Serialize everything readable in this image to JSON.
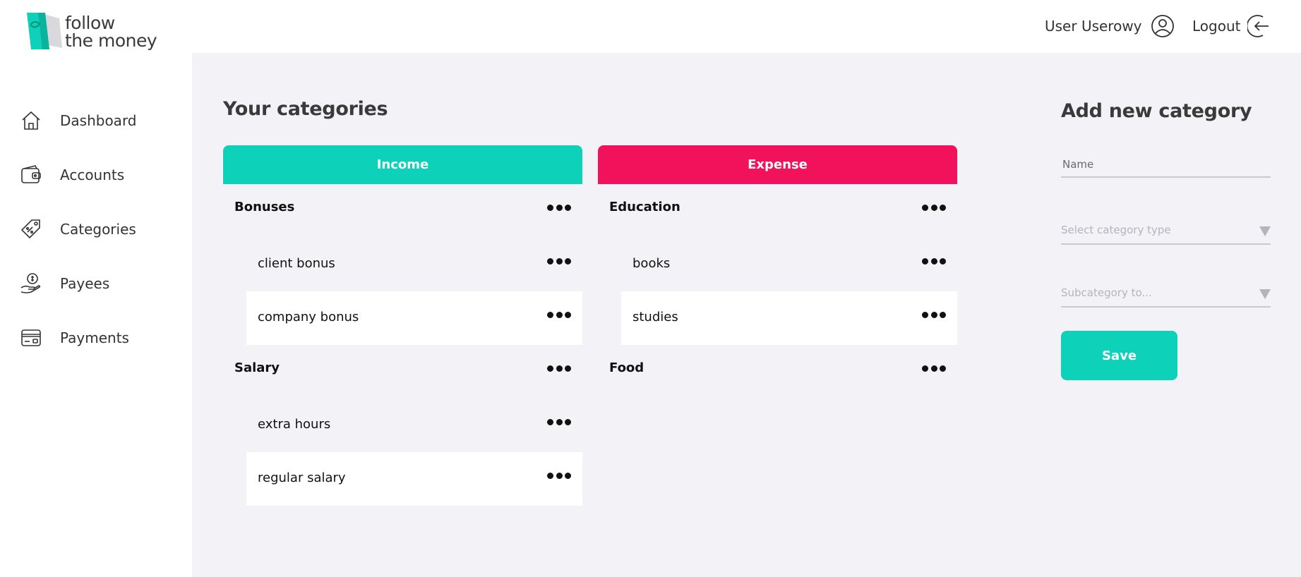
{
  "brand": {
    "line1": "follow",
    "line2": "the money",
    "accent": "#0dd1b8",
    "logo_secondary": "#d9d9dd"
  },
  "sidebar": {
    "items": [
      {
        "label": "Dashboard",
        "icon": "home-icon"
      },
      {
        "label": "Accounts",
        "icon": "wallet-icon"
      },
      {
        "label": "Categories",
        "icon": "tag-icon"
      },
      {
        "label": "Payees",
        "icon": "hand-coin-icon"
      },
      {
        "label": "Payments",
        "icon": "card-icon"
      }
    ]
  },
  "header": {
    "user_name": "User Userowy",
    "logout_label": "Logout"
  },
  "main": {
    "title": "Your categories",
    "income": {
      "header": "Income",
      "color": "#0dd1b8",
      "groups": [
        {
          "name": "Bonuses",
          "subs": [
            "client bonus",
            "company bonus"
          ]
        },
        {
          "name": "Salary",
          "subs": [
            "extra hours",
            "regular salary"
          ]
        }
      ]
    },
    "expense": {
      "header": "Expense",
      "color": "#f2125b",
      "groups": [
        {
          "name": "Education",
          "subs": [
            "books",
            "studies"
          ]
        },
        {
          "name": "Food",
          "subs": []
        }
      ]
    }
  },
  "form": {
    "title": "Add new category",
    "name_placeholder": "Name",
    "type_placeholder": "Select category type",
    "sub_placeholder": "Subcategory to...",
    "save_label": "Save"
  }
}
